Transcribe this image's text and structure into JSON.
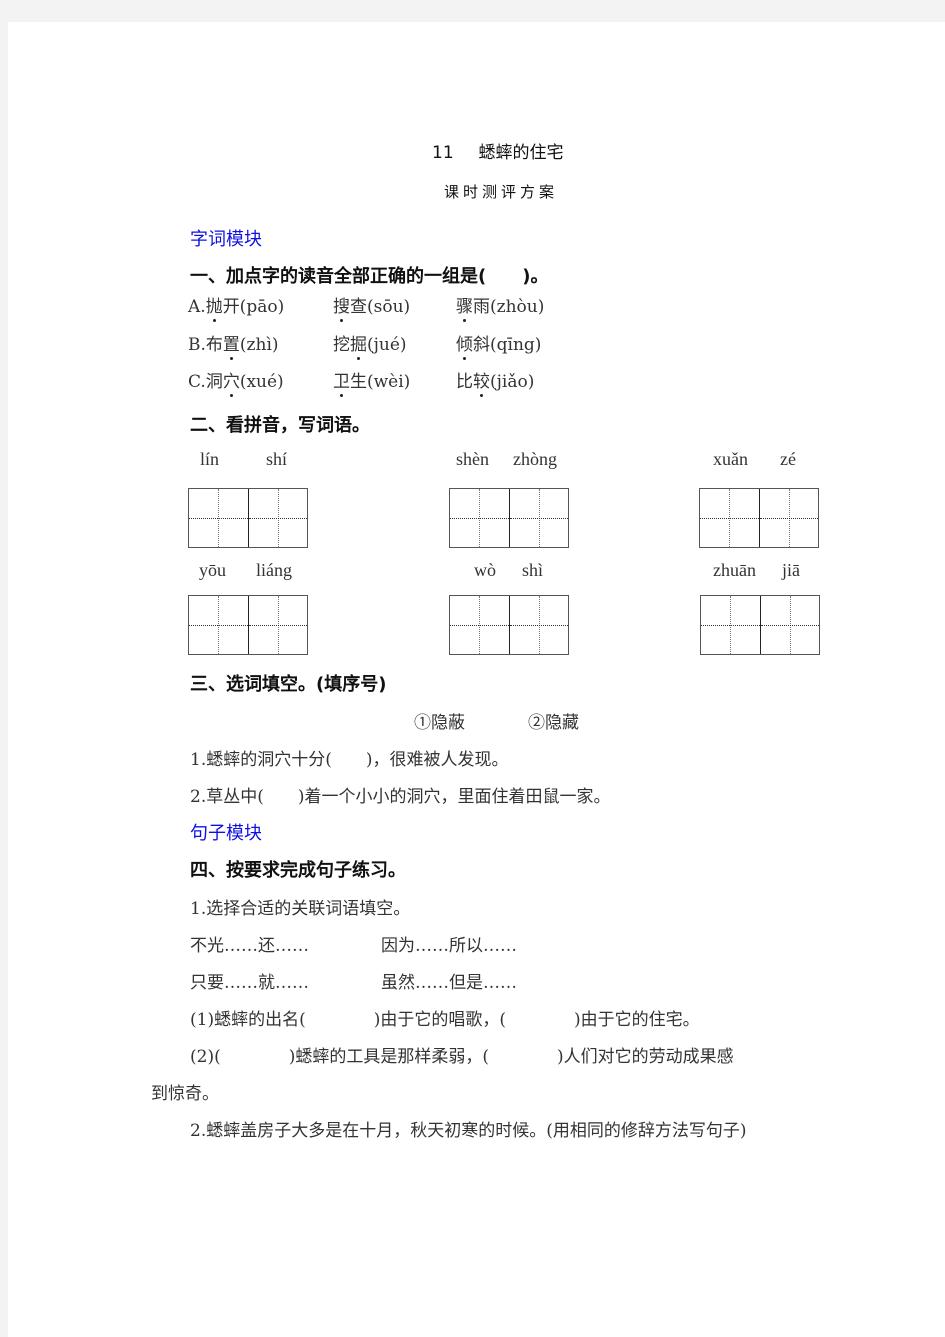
{
  "header": {
    "lesson_number": "11",
    "lesson_title": "蟋蟀的住宅",
    "subtitle": "课时测评方案"
  },
  "modules": {
    "words": "字词模块",
    "sentences": "句子模块"
  },
  "q1": {
    "heading": "一、加点字的读音全部正确的一组是(　　)。",
    "options": [
      {
        "label": "A.",
        "items": [
          {
            "pre": "",
            "dotted": "抛",
            "post": "开(pāo)"
          },
          {
            "pre": "",
            "dotted": "搜",
            "post": "查(sōu)"
          },
          {
            "pre": "",
            "dotted": "骤",
            "post": "雨(zhòu)"
          }
        ]
      },
      {
        "label": "B.",
        "items": [
          {
            "pre": "布",
            "dotted": "置",
            "post": "(zhì)"
          },
          {
            "pre": "挖",
            "dotted": "掘",
            "post": "(jué)"
          },
          {
            "pre": "",
            "dotted": "倾",
            "post": "斜(qīng)"
          }
        ]
      },
      {
        "label": "C.",
        "items": [
          {
            "pre": "洞",
            "dotted": "穴",
            "post": "(xué)"
          },
          {
            "pre": "",
            "dotted": "卫",
            "post": "生(wèi)"
          },
          {
            "pre": "比",
            "dotted": "较",
            "post": "(jiǎo)"
          }
        ]
      }
    ]
  },
  "q2": {
    "heading": "二、看拼音，写词语。",
    "words": [
      {
        "pinyin": [
          "lín",
          "shí"
        ]
      },
      {
        "pinyin": [
          "shèn",
          "zhòng"
        ]
      },
      {
        "pinyin": [
          "xuǎn",
          "zé"
        ]
      },
      {
        "pinyin": [
          "yōu",
          "liáng"
        ]
      },
      {
        "pinyin": [
          "wò",
          "shì"
        ]
      },
      {
        "pinyin": [
          "zhuān",
          "jiā"
        ]
      }
    ]
  },
  "q3": {
    "heading": "三、选词填空。(填序号)",
    "choices": [
      "①隐蔽",
      "②隐藏"
    ],
    "sentences": [
      "1.蟋蟀的洞穴十分(　　)，很难被人发现。",
      "2.草丛中(　　)着一个小小的洞穴，里面住着田鼠一家。"
    ]
  },
  "q4": {
    "heading": "四、按要求完成句子练习。",
    "part1_title": "1.选择合适的关联词语填空。",
    "conjunctions": [
      "不光……还……",
      "因为……所以……",
      "只要……就……",
      "虽然……但是……"
    ],
    "s1": "(1)蟋蟀的出名(　　　　)由于它的唱歌，(　　　　)由于它的住宅。",
    "s2_line1": "(2)(　　　　)蟋蟀的工具是那样柔弱，(　　　　)人们对它的劳动成果感",
    "s2_line2": "到惊奇。",
    "part2": "2.蟋蟀盖房子大多是在十月，秋天初寒的时候。(用相同的修辞方法写句子)"
  }
}
